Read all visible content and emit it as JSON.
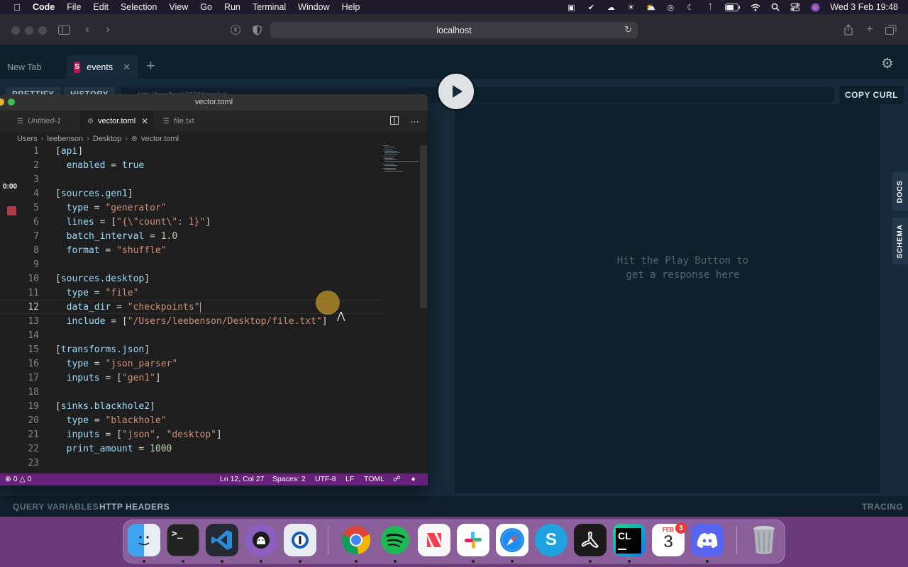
{
  "menubar": {
    "app_name": "Code",
    "items": [
      "File",
      "Edit",
      "Selection",
      "View",
      "Go",
      "Run",
      "Terminal",
      "Window",
      "Help"
    ],
    "clock": "Wed 3 Feb  19:48"
  },
  "browser": {
    "url": "localhost"
  },
  "playground": {
    "tabs": [
      {
        "label": "New Tab"
      },
      {
        "label": "events",
        "badge": "S"
      }
    ],
    "buttons": {
      "prettify": "PRETTIFY",
      "history": "HISTORY",
      "copy_curl": "COPY CURL"
    },
    "endpoint": "http://localhost:8686/graphql",
    "response_hint_line1": "Hit the Play Button to",
    "response_hint_line2": "get a response here",
    "side_tabs": {
      "docs": "DOCS",
      "schema": "SCHEMA"
    },
    "bottom": {
      "query_variables": "QUERY VARIABLES",
      "http_headers": "HTTP HEADERS",
      "tracing": "TRACING"
    }
  },
  "vscode": {
    "window_title": "vector.toml",
    "tabs": [
      {
        "label": "Untitled-1"
      },
      {
        "label": "vector.toml"
      },
      {
        "label": "file.txt"
      }
    ],
    "breadcrumb": [
      "Users",
      "leebenson",
      "Desktop",
      "vector.toml"
    ],
    "current_line": 12,
    "status": {
      "problems": "0",
      "warnings": "0",
      "position": "Ln 12, Col 27",
      "spaces": "Spaces: 2",
      "encoding": "UTF-8",
      "eol": "LF",
      "language": "TOML"
    }
  },
  "recording": {
    "time": "0:00"
  },
  "dock": {
    "apps": [
      {
        "name": "Finder",
        "color": "#2f8fe8"
      },
      {
        "name": "Terminal",
        "color": "#222222",
        "glyph": ">_"
      },
      {
        "name": "VS Code",
        "color": "#1f6fbf"
      },
      {
        "name": "GitHub Desktop",
        "color": "#7b4fa8"
      },
      {
        "name": "1Password",
        "color": "#dfe6ee"
      },
      {
        "name": "Chrome",
        "color": "#ffffff"
      },
      {
        "name": "Spotify",
        "color": "#1db954"
      },
      {
        "name": "News",
        "color": "#f5f5f5"
      },
      {
        "name": "Slack",
        "color": "#ffffff"
      },
      {
        "name": "Safari",
        "color": "#2f8fe8"
      },
      {
        "name": "Skype",
        "color": "#1ea3e0",
        "glyph": "S"
      },
      {
        "name": "Acrobat",
        "color": "#1a1a1a"
      },
      {
        "name": "CLion",
        "color": "#1aa84f",
        "glyph": "CL"
      },
      {
        "name": "Calendar",
        "color": "#ffffff",
        "month": "FEB",
        "day": "3",
        "badge": "3"
      },
      {
        "name": "Discord",
        "color": "#5865f2"
      },
      {
        "name": "Trash",
        "color": "#9aa0a6"
      }
    ]
  }
}
